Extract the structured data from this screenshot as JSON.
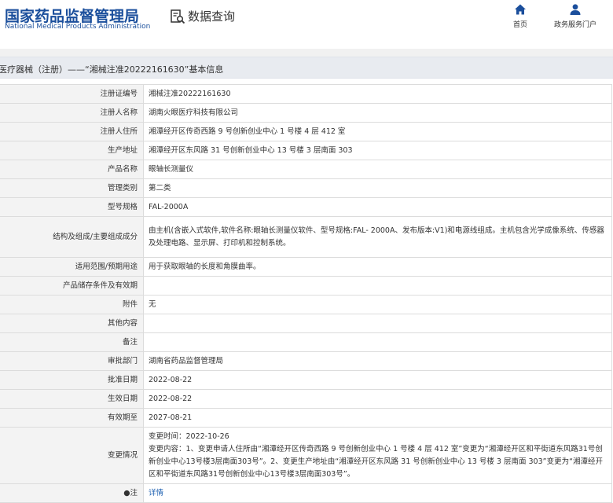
{
  "header": {
    "logo_cn": "国家药品监督管理局",
    "logo_en": "National Medical Products Administration",
    "query_label": "数据查询",
    "query_icon": "search-document-icon",
    "nav": [
      {
        "label": "首页",
        "icon": "home-icon"
      },
      {
        "label": "政务服务门户",
        "icon": "user-icon"
      }
    ],
    "brand_color": "#1b4f9c"
  },
  "title": "医疗器械（注册）——“湘械注准20222161630”基本信息",
  "rows": [
    {
      "key": "注册证编号",
      "value": "湘械注准20222161630"
    },
    {
      "key": "注册人名称",
      "value": "湖南火眼医疗科技有限公司"
    },
    {
      "key": "注册人住所",
      "value": "湘潭经开区传奇西路 9 号创新创业中心 1 号楼 4 层 412 室"
    },
    {
      "key": "生产地址",
      "value": "湘潭经开区东风路 31 号创新创业中心 13 号楼 3 层南面 303"
    },
    {
      "key": "产品名称",
      "value": "眼轴长测量仪"
    },
    {
      "key": "管理类别",
      "value": "第二类"
    },
    {
      "key": "型号规格",
      "value": "FAL-2000A"
    },
    {
      "key": "结构及组成/主要组成成分",
      "value": "由主机(含嵌入式软件,软件名称:眼轴长测量仪软件、型号规格:FAL- 2000A、发布版本:V1)和电源线组成。主机包含光学成像系统、传感器及处理电路、显示屏、打印机和控制系统。"
    },
    {
      "key": "适用范围/预期用途",
      "value": "用于获取眼轴的长度和角膜曲率。"
    },
    {
      "key": "产品储存条件及有效期",
      "value": ""
    },
    {
      "key": "附件",
      "value": "无"
    },
    {
      "key": "其他内容",
      "value": ""
    },
    {
      "key": "备注",
      "value": ""
    },
    {
      "key": "审批部门",
      "value": "湖南省药品监督管理局"
    },
    {
      "key": "批准日期",
      "value": "2022-08-22"
    },
    {
      "key": "生效日期",
      "value": "2022-08-22"
    },
    {
      "key": "有效期至",
      "value": "2027-08-21"
    },
    {
      "key": "变更情况",
      "value": "变更时间：2022-10-26\n变更内容：1、变更申请人住所由“湘潭经开区传奇西路 9 号创新创业中心 1 号楼 4 层 412 室”变更为“湘潭经开区和平街道东风路31号创新创业中心13号楼3层南面303号”。2、变更生产地址由“湘潭经开区东风路 31 号创新创业中心 13 号楼 3 层南面 303”变更为“湘潭经开区和平街道东风路31号创新创业中心13号楼3层南面303号”。"
    },
    {
      "key": "●注",
      "value": "详情",
      "link": true
    }
  ]
}
